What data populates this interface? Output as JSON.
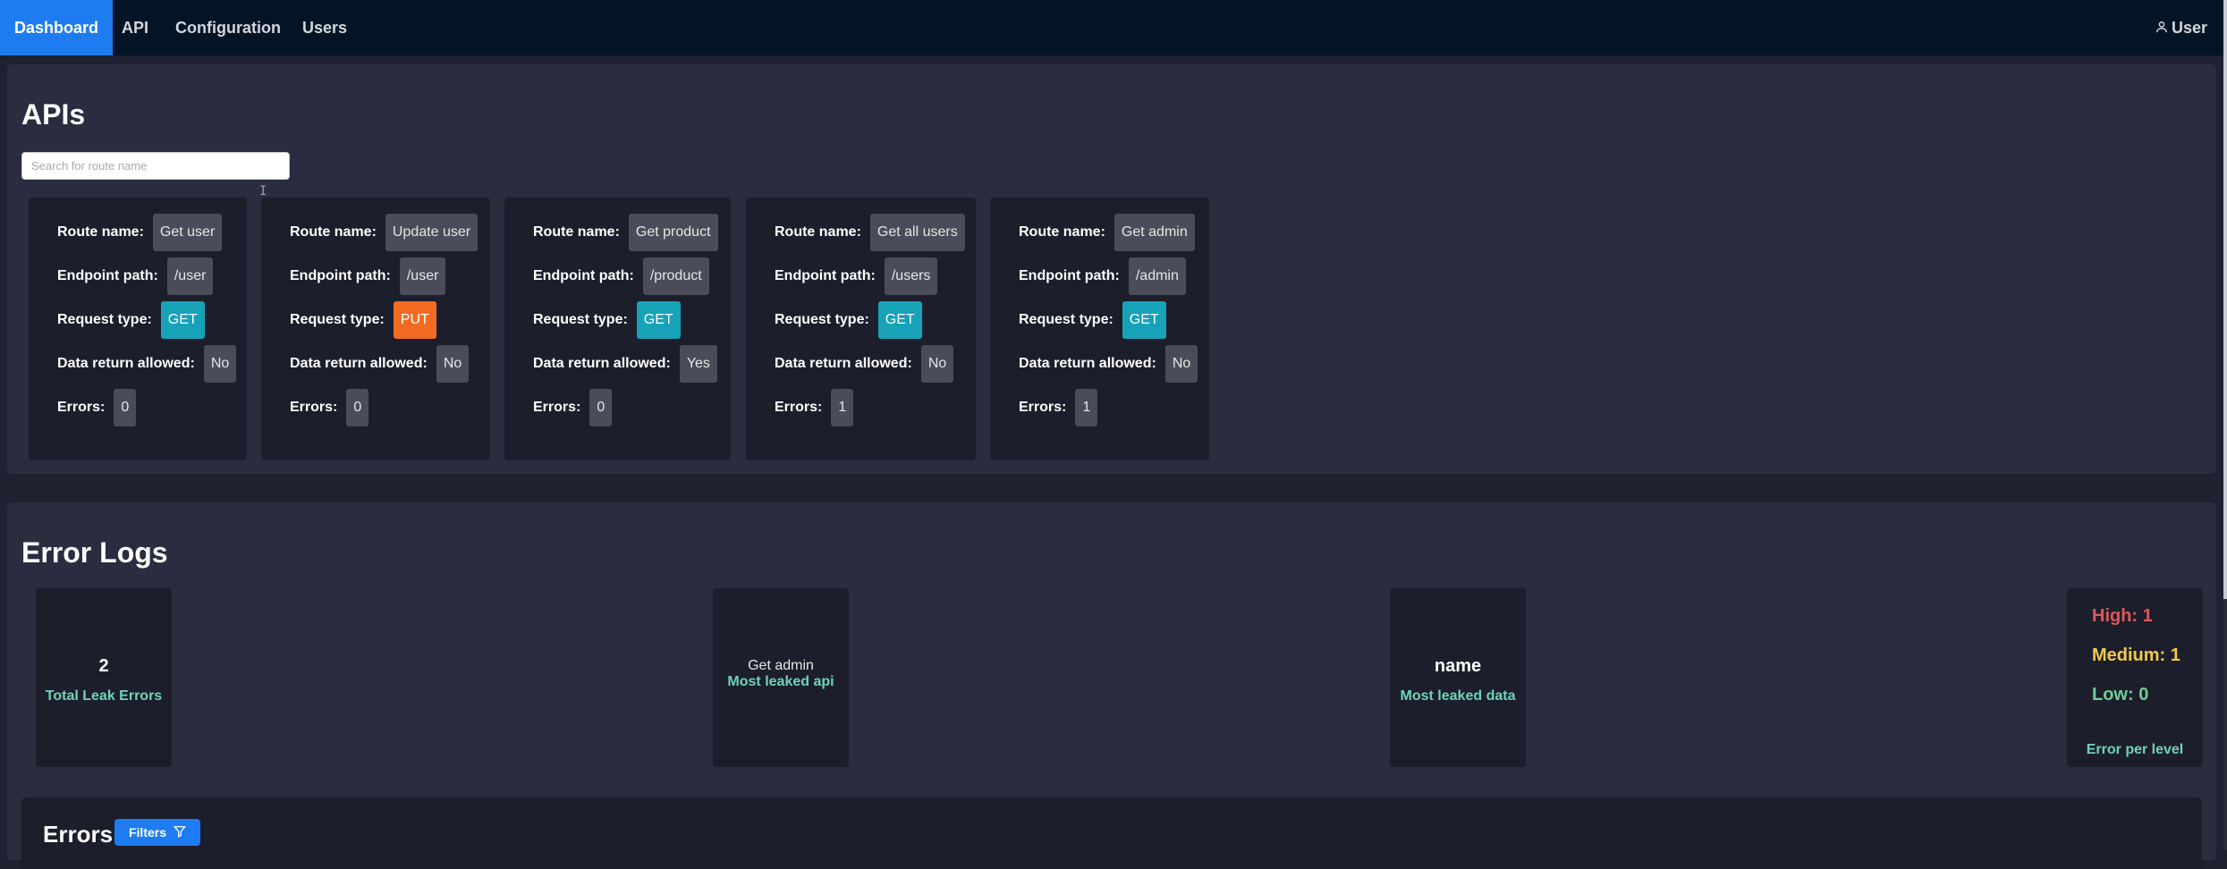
{
  "nav": {
    "items": [
      "Dashboard",
      "API",
      "Configuration",
      "Users"
    ],
    "user_label": "User"
  },
  "apis": {
    "title": "APIs",
    "search_placeholder": "Search for route name",
    "labels": {
      "route": "Route name:",
      "endpoint": "Endpoint path:",
      "request": "Request type:",
      "data_return": "Data return allowed:",
      "errors": "Errors:"
    },
    "cards": [
      {
        "route": "Get user",
        "endpoint": "/user",
        "request": "GET",
        "data_return": "No",
        "errors": "0"
      },
      {
        "route": "Update user",
        "endpoint": "/user",
        "request": "PUT",
        "data_return": "No",
        "errors": "0"
      },
      {
        "route": "Get product",
        "endpoint": "/product",
        "request": "GET",
        "data_return": "Yes",
        "errors": "0"
      },
      {
        "route": "Get all users",
        "endpoint": "/users",
        "request": "GET",
        "data_return": "No",
        "errors": "1"
      },
      {
        "route": "Get admin",
        "endpoint": "/admin",
        "request": "GET",
        "data_return": "No",
        "errors": "1"
      }
    ]
  },
  "error_logs": {
    "title": "Error Logs",
    "total_leak_errors": {
      "value": "2",
      "label": "Total Leak Errors"
    },
    "most_leaked_api": {
      "value": "Get admin",
      "label": "Most leaked api"
    },
    "most_leaked_data": {
      "value": "name",
      "label": "Most leaked data"
    },
    "levels": {
      "high": "High: 1",
      "medium": "Medium: 1",
      "low": "Low: 0",
      "label": "Error per level"
    },
    "errors_title": "Errors",
    "filters_label": "Filters"
  },
  "colors": {
    "accent": "#1f7cf0",
    "get": "#17a2b8",
    "put": "#f26b22",
    "high": "#e0565b",
    "medium": "#f2c94c",
    "low": "#6fcf97",
    "stat_label": "#6fd3b8"
  },
  "icons": {
    "user": "user-icon",
    "filter": "filter-icon"
  }
}
